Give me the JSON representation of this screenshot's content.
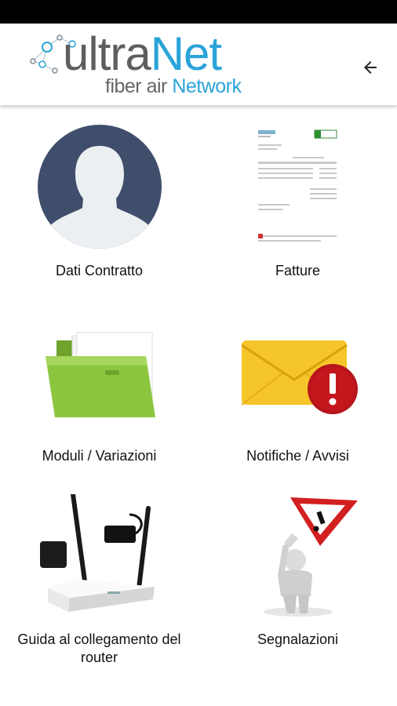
{
  "app": {
    "logo_main_a": "ultra",
    "logo_main_b": "Net",
    "logo_sub_a": "fiber air ",
    "logo_sub_b": "Network"
  },
  "toolbar": {
    "back_icon": "arrow-left-icon"
  },
  "menu": [
    {
      "label": "Dati Contratto",
      "icon": "user-avatar-icon"
    },
    {
      "label": "Fatture",
      "icon": "invoice-document-icon"
    },
    {
      "label": "Moduli / Variazioni",
      "icon": "green-folder-icon"
    },
    {
      "label": "Notifiche / Avvisi",
      "icon": "envelope-alert-icon"
    },
    {
      "label": "Guida al collegamento del router",
      "icon": "router-icon"
    },
    {
      "label": "Segnalazioni",
      "icon": "warning-sign-icon"
    }
  ],
  "colors": {
    "brand_blue": "#2aa3d8",
    "avatar_bg": "#3f4e6b",
    "folder_green": "#8cc63f",
    "alert_red": "#b5151b"
  }
}
